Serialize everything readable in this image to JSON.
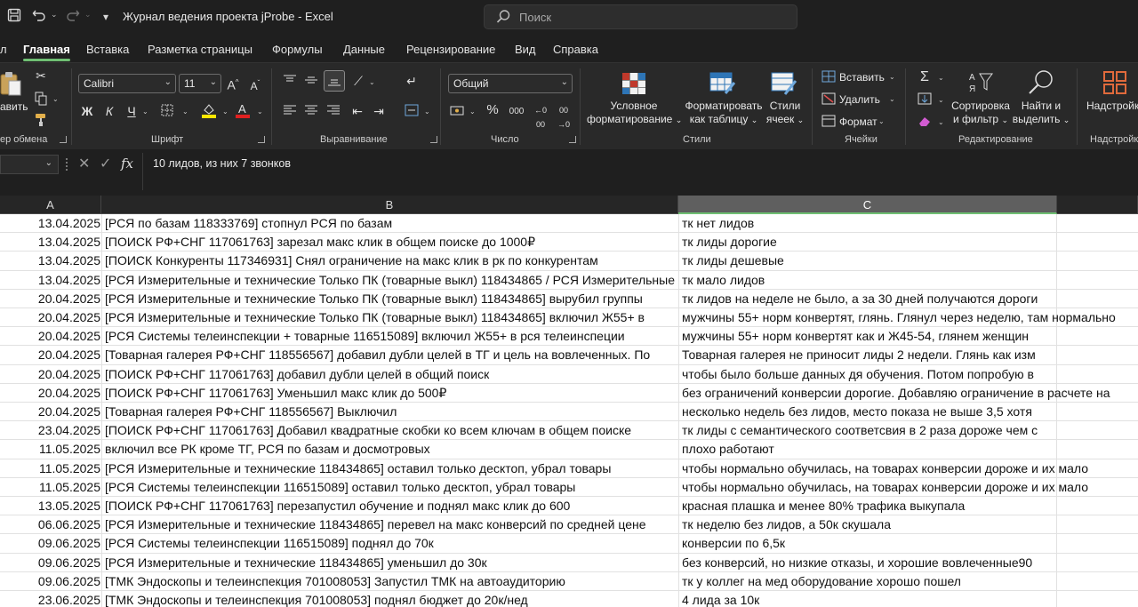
{
  "titlebar": {
    "title": "Журнал ведения проекта jProbe  -  Excel",
    "search_placeholder": "Поиск"
  },
  "tabs": [
    {
      "label": "л"
    },
    {
      "label": "Главная"
    },
    {
      "label": "Вставка"
    },
    {
      "label": "Разметка страницы"
    },
    {
      "label": "Формулы"
    },
    {
      "label": "Данные"
    },
    {
      "label": "Рецензирование"
    },
    {
      "label": "Вид"
    },
    {
      "label": "Справка"
    }
  ],
  "ribbon": {
    "clipboard": {
      "paste_label": "авить",
      "group_label": "ер обмена"
    },
    "font": {
      "font_name": "Calibri",
      "font_size": "11",
      "group_label": "Шрифт",
      "bold": "Ж",
      "italic": "К",
      "underline": "Ч"
    },
    "alignment": {
      "group_label": "Выравнивание"
    },
    "number": {
      "format": "Общий",
      "group_label": "Число",
      "percent": "%",
      "thousands": "000"
    },
    "styles": {
      "conditional_line1": "Условное",
      "conditional_line2": "форматирование",
      "table_line1": "Форматировать",
      "table_line2": "как таблицу",
      "cell_styles_line1": "Стили",
      "cell_styles_line2": "ячеек",
      "group_label": "Стили"
    },
    "cells": {
      "insert": "Вставить",
      "delete": "Удалить",
      "format": "Формат",
      "group_label": "Ячейки"
    },
    "editing": {
      "sort_line1": "Сортировка",
      "sort_line2": "и фильтр",
      "find_line1": "Найти и",
      "find_line2": "выделить",
      "group_label": "Редактирование"
    },
    "addins": {
      "label": "Надстройки",
      "group_label": "Надстройки"
    }
  },
  "formula_bar": {
    "fx": "fx",
    "content": "10 лидов, из них 7 звонков"
  },
  "columns": {
    "a": "A",
    "b": "B",
    "c": "C"
  },
  "rows": [
    {
      "a": "13.04.2025",
      "b": "[РСЯ по базам 118333769] стопнул РСЯ по базам",
      "c": "тк нет лидов"
    },
    {
      "a": "13.04.2025",
      "b": "[ПОИСК РФ+СНГ 117061763] зарезал макс клик в общем поиске до 1000₽",
      "c": "тк лиды дорогие"
    },
    {
      "a": "13.04.2025",
      "b": "[ПОИСК Конкуренты 117346931] Снял ограничение на макс клик в рк по конкурентам",
      "c": "тк лиды дешевые"
    },
    {
      "a": "13.04.2025",
      "b": "[РСЯ Измерительные и технические Только ПК (товарные выкл) 118434865 / РСЯ Измерительные",
      "c": "тк мало лидов"
    },
    {
      "a": "20.04.2025",
      "b": "[РСЯ Измерительные и технические Только ПК (товарные выкл) 118434865] вырубил группы",
      "c": "тк лидов на неделе не было, а за 30 дней получаются дороги"
    },
    {
      "a": "20.04.2025",
      "b": "[РСЯ Измерительные и технические Только ПК (товарные выкл) 118434865] включил Ж55+ в",
      "c": "мужчины 55+ норм конвертят, глянь. Глянул через неделю, там нормально"
    },
    {
      "a": "20.04.2025",
      "b": "[РСЯ Системы телеинспекции + товарные 116515089] включил Ж55+ в рся телеинспеции",
      "c": "мужчины 55+ норм конвертят как и Ж45-54, глянем женщин"
    },
    {
      "a": "20.04.2025",
      "b": "[Товарная галерея РФ+СНГ 118556567] добавил дубли целей в ТГ и цель на вовлеченных. По",
      "c": "Товарная галерея не приносит лиды 2 недели. Глянь как изм"
    },
    {
      "a": "20.04.2025",
      "b": "[ПОИСК РФ+СНГ 117061763] добавил дубли целей в общий поиск",
      "c": "чтобы было больше данных дя обучения. Потом попробую в"
    },
    {
      "a": "20.04.2025",
      "b": "[ПОИСК РФ+СНГ 117061763] Уменьшил макс клик до 500₽",
      "c": "без ограничений конверсии дорогие. Добавляю ограничение в расчете на"
    },
    {
      "a": "20.04.2025",
      "b": "[Товарная галерея РФ+СНГ 118556567] Выключил",
      "c": "несколько недель без лидов, место показа не выше 3,5 хотя"
    },
    {
      "a": "23.04.2025",
      "b": "[ПОИСК РФ+СНГ 117061763] Добавил квадратные скобки ко всем ключам в общем поиске",
      "c": "тк лиды с семантического соответсвия в 2 раза дороже чем с"
    },
    {
      "a": "11.05.2025",
      "b": "включил все РК кроме ТГ, РСЯ по базам и досмотровых",
      "c": "плохо работают"
    },
    {
      "a": "11.05.2025",
      "b": "[РСЯ Измерительные и технические 118434865] оставил только десктоп, убрал товары",
      "c": "чтобы нормально обучилась, на товарах конверсии дороже и их мало"
    },
    {
      "a": "11.05.2025",
      "b": "[РСЯ Системы телеинспекции 116515089] оставил только десктоп, убрал товары",
      "c": "чтобы нормально обучилась, на товарах конверсии дороже и их мало"
    },
    {
      "a": "13.05.2025",
      "b": "[ПОИСК РФ+СНГ 117061763] перезапустил обучение и поднял макс клик до 600",
      "c": "красная плашка и менее 80% трафика выкупала"
    },
    {
      "a": "06.06.2025",
      "b": "[РСЯ Измерительные и технические 118434865] перевел на макс конверсий по средней цене",
      "c": "тк неделю без лидов, а 50к скушала"
    },
    {
      "a": "09.06.2025",
      "b": "[РСЯ Системы телеинспекции 116515089] поднял до 70к",
      "c": "конверсии по 6,5к"
    },
    {
      "a": "09.06.2025",
      "b": "[РСЯ Измерительные и технические 118434865] уменьшил до 30к",
      "c": "без конверсий, но низкие отказы, и хорошие вовлеченные90"
    },
    {
      "a": "09.06.2025",
      "b": "[ТМК Эндоскопы и телеинспекция 701008053] Запустил ТМК на автоаудиторию",
      "c": "тк у коллег на мед оборудование хорошо пошел"
    },
    {
      "a": "23.06.2025",
      "b": "[ТМК Эндоскопы и телеинспекция 701008053] поднял бюджет до 20к/нед",
      "c": "4 лида за 10к"
    }
  ]
}
